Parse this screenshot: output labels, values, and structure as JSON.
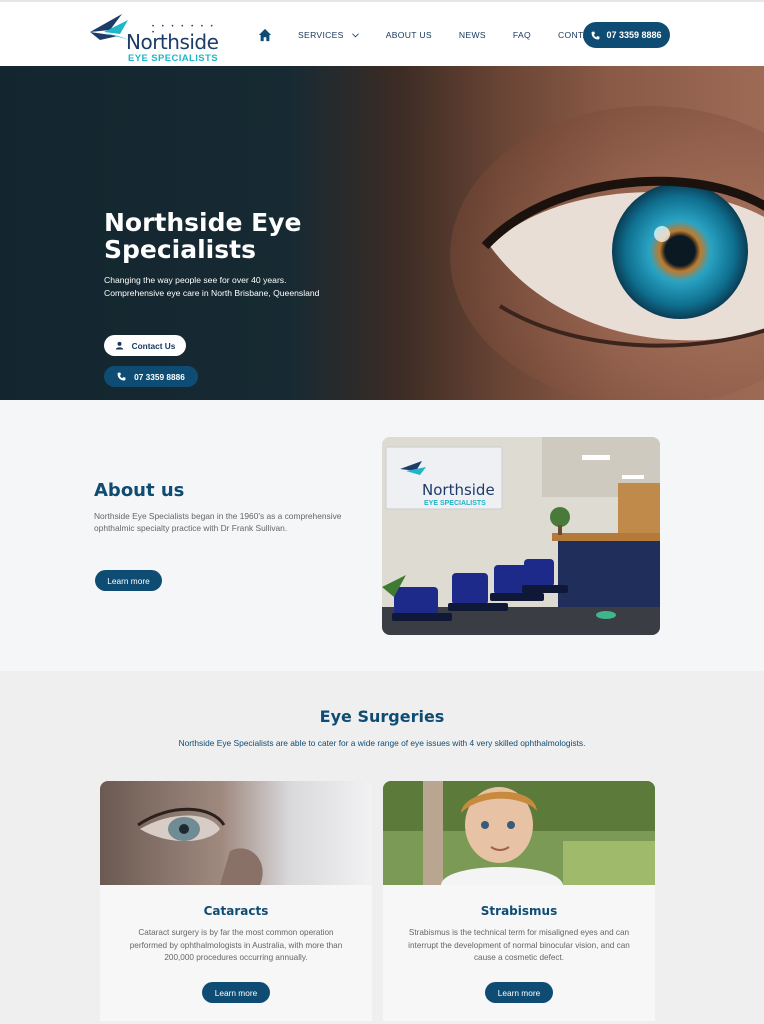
{
  "header": {
    "logo": {
      "name": "Northside",
      "sub": "EYE SPECIALISTS"
    },
    "nav": [
      {
        "label": "SERVICES"
      },
      {
        "label": "ABOUT US"
      },
      {
        "label": "NEWS"
      },
      {
        "label": "FAQ"
      },
      {
        "label": "CONTACT US"
      }
    ],
    "phone": "07 3359 8886"
  },
  "hero": {
    "title": "Northside Eye Specialists",
    "text_line1": "Changing the way people see for over 40 years.",
    "text_line2": "Comprehensive eye care in North Brisbane, Queensland",
    "contact_label": "Contact Us",
    "phone_label": "07 3359 8886"
  },
  "about": {
    "title": "About us",
    "text": "Northside Eye Specialists began in the 1960's as a comprehensive ophthalmic specialty practice with Dr Frank Sullivan.",
    "button": "Learn more",
    "sign_name": "Northside",
    "sign_sub": "EYE SPECIALISTS"
  },
  "surgeries": {
    "title": "Eye Surgeries",
    "subtitle": "Northside Eye Specialists are able to cater for a wide range of eye issues with 4 very skilled ophthalmologists.",
    "cards": [
      {
        "title": "Cataracts",
        "text": "Cataract surgery is by far the most common operation performed by ophthalmologists in Australia, with more than 200,000 procedures occurring annually.",
        "button": "Learn more"
      },
      {
        "title": "Strabismus",
        "text": "Strabismus is the technical term for misaligned eyes and can interrupt the development of normal binocular vision, and can cause a cosmetic defect.",
        "button": "Learn more"
      }
    ]
  },
  "colors": {
    "brand_blue": "#0f4c74",
    "accent_teal": "#1fb6c8",
    "navy": "#16365c"
  }
}
